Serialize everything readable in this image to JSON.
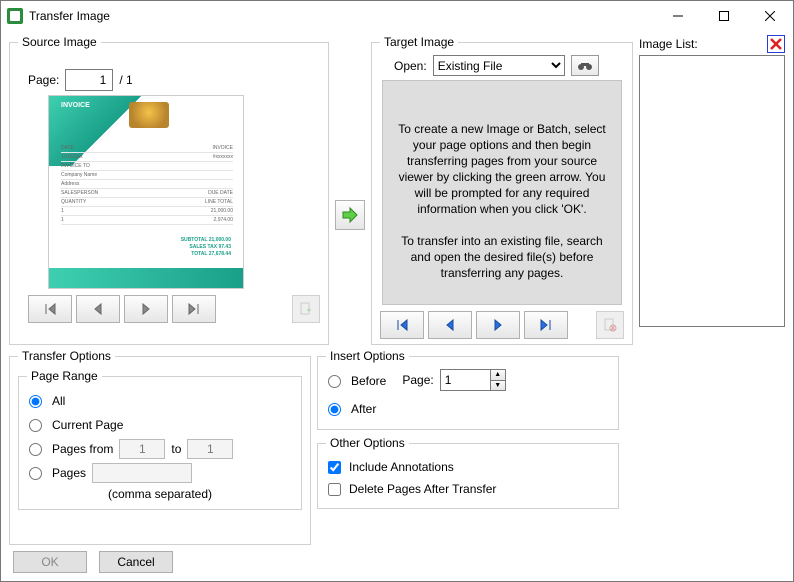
{
  "window": {
    "title": "Transfer Image"
  },
  "source": {
    "legend": "Source Image",
    "page_label": "Page:",
    "page_value": "1",
    "total_pages": "/ 1",
    "invoice_title": "INVOICE"
  },
  "target": {
    "legend": "Target Image",
    "open_label": "Open:",
    "open_selected": "Existing File",
    "instructions1": "To create a new Image or Batch, select your page options and then begin transferring pages from your source viewer by clicking the green arrow. You will be prompted for any required information when you click 'OK'.",
    "instructions2": "To transfer into an existing file, search and open the desired file(s) before transferring any pages."
  },
  "image_list": {
    "label": "Image List:"
  },
  "transfer_options": {
    "legend": "Transfer Options",
    "page_range_legend": "Page Range",
    "all": "All",
    "current_page": "Current Page",
    "pages_from": "Pages from",
    "to": "to",
    "from_value": "1",
    "to_value": "1",
    "pages": "Pages",
    "comma_sep": "(comma separated)"
  },
  "insert_options": {
    "legend": "Insert Options",
    "before": "Before",
    "after": "After",
    "page_label": "Page:",
    "page_value": "1"
  },
  "other_options": {
    "legend": "Other Options",
    "include_annotations": "Include Annotations",
    "delete_after": "Delete Pages After Transfer"
  },
  "footer": {
    "ok": "OK",
    "cancel": "Cancel"
  }
}
